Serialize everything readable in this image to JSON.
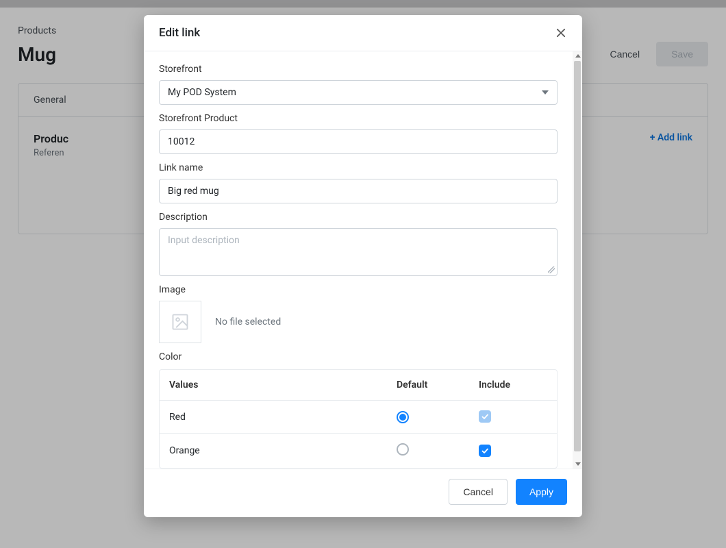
{
  "background": {
    "breadcrumb": "Products",
    "title": "Mug",
    "cancel": "Cancel",
    "save": "Save",
    "tab_general": "General",
    "panel_head": "Produc",
    "panel_sub": "Referen",
    "add_link": "+ Add link"
  },
  "modal": {
    "title": "Edit link",
    "storefront_label": "Storefront",
    "storefront_value": "My POD System",
    "storefront_product_label": "Storefront Product",
    "storefront_product_value": "10012",
    "linkname_label": "Link name",
    "linkname_value": "Big red mug",
    "description_label": "Description",
    "description_placeholder": "Input description",
    "image_label": "Image",
    "image_helper": "No file selected",
    "color_label": "Color",
    "grid": {
      "col_values": "Values",
      "col_default": "Default",
      "col_include": "Include",
      "rows": [
        {
          "value": "Red",
          "default": true,
          "include_locked": true
        },
        {
          "value": "Orange",
          "default": false,
          "include": true
        }
      ]
    },
    "footer": {
      "cancel": "Cancel",
      "apply": "Apply"
    }
  }
}
